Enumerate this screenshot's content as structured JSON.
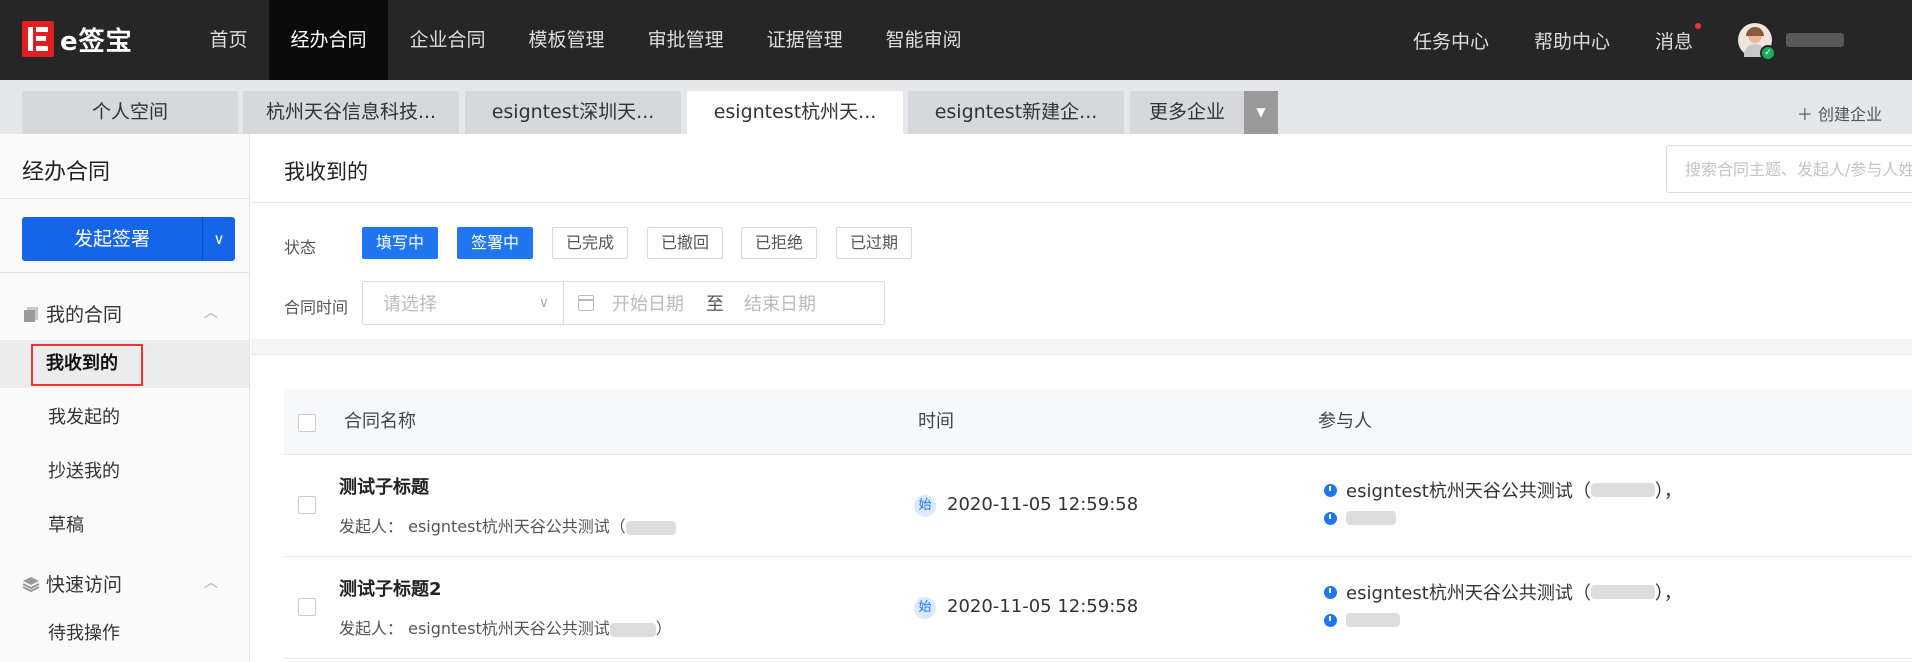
{
  "brand": {
    "name": "e签宝",
    "color": "#e02020"
  },
  "nav": {
    "items": [
      {
        "label": "首页"
      },
      {
        "label": "经办合同",
        "active": true
      },
      {
        "label": "企业合同"
      },
      {
        "label": "模板管理"
      },
      {
        "label": "审批管理"
      },
      {
        "label": "证据管理"
      },
      {
        "label": "智能审阅"
      }
    ],
    "task_center": "任务中心",
    "help_center": "帮助中心",
    "messages": "消息"
  },
  "tabs": {
    "items": [
      {
        "label": "个人空间"
      },
      {
        "label": "杭州天谷信息科技..."
      },
      {
        "label": "esigntest深圳天..."
      },
      {
        "label": "esigntest杭州天...",
        "active": true
      },
      {
        "label": "esigntest新建企..."
      },
      {
        "label": "更多企业"
      }
    ],
    "create": "创建企业"
  },
  "sidebar": {
    "title": "经办合同",
    "launch_button": "发起签署",
    "groups": [
      {
        "label": "我的合同",
        "icon": "documents-icon",
        "items": [
          {
            "label": "我收到的",
            "selected": true
          },
          {
            "label": "我发起的"
          },
          {
            "label": "抄送我的"
          },
          {
            "label": "草稿"
          }
        ]
      },
      {
        "label": "快速访问",
        "icon": "layers-icon",
        "items": [
          {
            "label": "待我操作"
          }
        ]
      }
    ]
  },
  "main": {
    "title": "我收到的",
    "search_placeholder": "搜索合同主题、发起人/参与人姓名",
    "filters": {
      "status_label": "状态",
      "statuses": [
        {
          "label": "填写中",
          "active": true
        },
        {
          "label": "签署中",
          "active": true
        },
        {
          "label": "已完成"
        },
        {
          "label": "已撤回"
        },
        {
          "label": "已拒绝"
        },
        {
          "label": "已过期"
        }
      ],
      "time_label": "合同时间",
      "select_placeholder": "请选择",
      "start_date": "开始日期",
      "separator": "至",
      "end_date": "结束日期"
    },
    "table": {
      "columns": [
        "合同名称",
        "时间",
        "参与人"
      ],
      "rows": [
        {
          "title": "测试子标题",
          "initiator_label": "发起人：",
          "initiator": "esigntest杭州天谷公共测试（",
          "time_badge": "始",
          "time": "2020-11-05 12:59:58",
          "participant": "esigntest杭州天谷公共测试（",
          "participant_end": "），"
        },
        {
          "title": "测试子标题2",
          "initiator_label": "发起人：",
          "initiator": "esigntest杭州天谷公共测试",
          "initiator_end": "）",
          "time_badge": "始",
          "time": "2020-11-05 12:59:58",
          "participant": "esigntest杭州天谷公共测试（",
          "participant_end": "），"
        }
      ]
    }
  },
  "colors": {
    "primary": "#1565e8",
    "topbar": "#262626",
    "highlight_border": "#e33333"
  }
}
